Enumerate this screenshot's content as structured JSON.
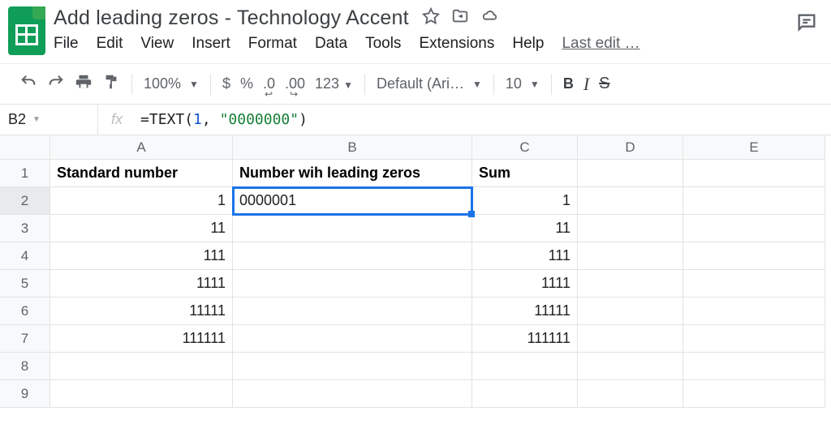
{
  "doc": {
    "title": "Add leading zeros - Technology Accent"
  },
  "menus": {
    "file": "File",
    "edit": "Edit",
    "view": "View",
    "insert": "Insert",
    "format": "Format",
    "data": "Data",
    "tools": "Tools",
    "extensions": "Extensions",
    "help": "Help",
    "last_edit": "Last edit …"
  },
  "toolbar": {
    "zoom": "100%",
    "currency": "$",
    "percent": "%",
    "dec_dec": ".0",
    "inc_dec": ".00",
    "num_format": "123",
    "font": "Default (Ari…",
    "font_size": "10",
    "bold": "B",
    "italic": "I",
    "strike": "S"
  },
  "namebox": "B2",
  "formula": {
    "prefix": "=TEXT(",
    "arg1": "1",
    "comma": ", ",
    "arg2": "\"0000000\"",
    "suffix": ")"
  },
  "columns": {
    "A": "A",
    "B": "B",
    "C": "C",
    "D": "D",
    "E": "E"
  },
  "rows": {
    "r1": {
      "n": "1",
      "A": "Standard number",
      "B": "Number wih leading zeros",
      "C": "Sum",
      "D": "",
      "E": ""
    },
    "r2": {
      "n": "2",
      "A": "1",
      "B": "0000001",
      "C": "1",
      "D": "",
      "E": ""
    },
    "r3": {
      "n": "3",
      "A": "11",
      "B": "",
      "C": "11",
      "D": "",
      "E": ""
    },
    "r4": {
      "n": "4",
      "A": "111",
      "B": "",
      "C": "111",
      "D": "",
      "E": ""
    },
    "r5": {
      "n": "5",
      "A": "1111",
      "B": "",
      "C": "1111",
      "D": "",
      "E": ""
    },
    "r6": {
      "n": "6",
      "A": "11111",
      "B": "",
      "C": "11111",
      "D": "",
      "E": ""
    },
    "r7": {
      "n": "7",
      "A": "111111",
      "B": "",
      "C": "111111",
      "D": "",
      "E": ""
    },
    "r8": {
      "n": "8",
      "A": "",
      "B": "",
      "C": "",
      "D": "",
      "E": ""
    },
    "r9": {
      "n": "9",
      "A": "",
      "B": "",
      "C": "",
      "D": "",
      "E": ""
    }
  }
}
